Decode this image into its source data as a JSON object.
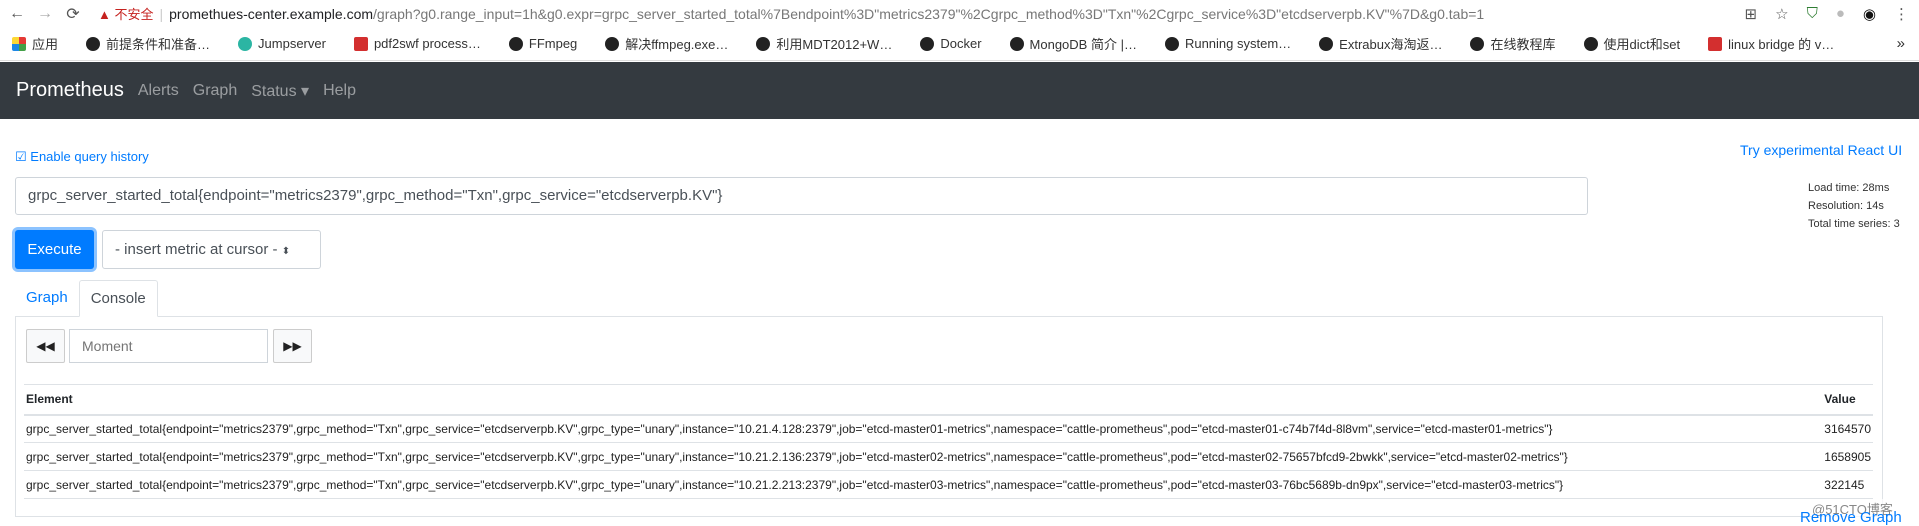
{
  "browser": {
    "insecure_label": "不安全",
    "url_host": "promethues-center.example.com",
    "url_path": "/graph?g0.range_input=1h&g0.expr=grpc_server_started_total%7Bendpoint%3D\"metrics2379\"%2Cgrpc_method%3D\"Txn\"%2Cgrpc_service%3D\"etcdserverpb.KV\"%7D&g0.tab=1",
    "bookmarks": [
      "应用",
      "前提条件和准备…",
      "Jumpserver",
      "pdf2swf process…",
      "FFmpeg",
      "解决ffmpeg.exe…",
      "利用MDT2012+W…",
      "Docker",
      "MongoDB 简介 |…",
      "Running system…",
      "Extrabux海淘返…",
      "在线教程库",
      "使用dict和set",
      "linux bridge 的 v…"
    ],
    "bookmark_icons": [
      "apps-icon",
      "diamond-icon",
      "jumpserver-icon",
      "csdn-icon",
      "globe-icon",
      "globe-icon",
      "globe-icon",
      "book-icon",
      "globe-icon",
      "globe-icon",
      "globe-icon",
      "globe-icon",
      "rocket-icon",
      "csdn-icon"
    ]
  },
  "navbar": {
    "brand": "Prometheus",
    "links": [
      "Alerts",
      "Graph",
      "Status ▾",
      "Help"
    ]
  },
  "query": {
    "history_label": "Enable query history",
    "react_link": "Try experimental React UI",
    "expression": "grpc_server_started_total{endpoint=\"metrics2379\",grpc_method=\"Txn\",grpc_service=\"etcdserverpb.KV\"}",
    "execute_label": "Execute",
    "insert_metric_label": "- insert metric at cursor -",
    "stats": {
      "load_time": "Load time: 28ms",
      "resolution": "Resolution: 14s",
      "total_series": "Total time series: 3"
    }
  },
  "tabs": [
    "Graph",
    "Console"
  ],
  "active_tab": "Console",
  "console": {
    "moment_placeholder": "Moment",
    "columns": [
      "Element",
      "Value"
    ],
    "rows": [
      {
        "element": "grpc_server_started_total{endpoint=\"metrics2379\",grpc_method=\"Txn\",grpc_service=\"etcdserverpb.KV\",grpc_type=\"unary\",instance=\"10.21.4.128:2379\",job=\"etcd-master01-metrics\",namespace=\"cattle-prometheus\",pod=\"etcd-master01-c74b7f4d-8l8vm\",service=\"etcd-master01-metrics\"}",
        "value": "3164570"
      },
      {
        "element": "grpc_server_started_total{endpoint=\"metrics2379\",grpc_method=\"Txn\",grpc_service=\"etcdserverpb.KV\",grpc_type=\"unary\",instance=\"10.21.2.136:2379\",job=\"etcd-master02-metrics\",namespace=\"cattle-prometheus\",pod=\"etcd-master02-75657bfcd9-2bwkk\",service=\"etcd-master02-metrics\"}",
        "value": "1658905"
      },
      {
        "element": "grpc_server_started_total{endpoint=\"metrics2379\",grpc_method=\"Txn\",grpc_service=\"etcdserverpb.KV\",grpc_type=\"unary\",instance=\"10.21.2.213:2379\",job=\"etcd-master03-metrics\",namespace=\"cattle-prometheus\",pod=\"etcd-master03-76bc5689b-dn9px\",service=\"etcd-master03-metrics\"}",
        "value": "322145"
      }
    ]
  },
  "remove_graph": "Remove Graph",
  "watermark": "@51CTO博客",
  "colors": {
    "navbar": "#343a40",
    "accent": "#007bff"
  }
}
